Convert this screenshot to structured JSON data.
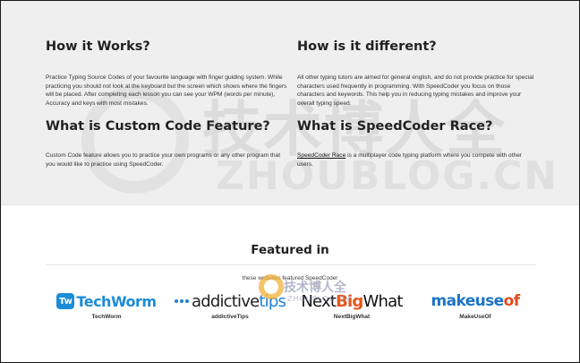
{
  "sections": {
    "how_it_works": {
      "title": "How it Works?",
      "body": "Practice Typing Source Codes of your favourite language with finger guiding system. While practicing you should not look at the keyboard but the screen which shows where the fingers will be placed. After completing each lesson you can see your WPM (words per minute), Accuracy and keys with most mistakes."
    },
    "how_different": {
      "title": "How is it different?",
      "body": "All other typing tutors are aimed for general english, and do not provide practice for special characters used frequently in programming. With SpeedCoder you focus on those characters and keywords. This help you in reducing typing mistakes and improve your overall typing speed."
    },
    "custom_code": {
      "title": "What is Custom Code Feature?",
      "body": "Custom Code feature allows you to practice your own programs or any other program that you would like to practice using SpeedCoder."
    },
    "race": {
      "title": "What is SpeedCoder Race?",
      "link": "SpeedCoder Race",
      "body": " is a multiplayer code typing platform where you compete with other users."
    }
  },
  "watermark": {
    "cn": "技术博人全",
    "en": "ZHOUBLOG.CN",
    "small_cn": "技术博人全",
    "small_en": "ZHOUBLOG.CN"
  },
  "featured": {
    "title": "Featured in",
    "subtitle": "these websites featured SpeedCoder",
    "logos": [
      {
        "brand": "TechWorm",
        "caption": "TechWorm",
        "badge": "Tw",
        "color": "#1b8cd8"
      },
      {
        "brand_main": "addictive",
        "brand_accent": "tips",
        "caption": "addictiveTips",
        "color": "#1e7fd6"
      },
      {
        "brand_pre": "Next",
        "brand_accent": "Big",
        "brand_post": "What",
        "caption": "NextBigWhat",
        "color": "#e8551b"
      },
      {
        "brand_main": "makeuse",
        "brand_accent": "of",
        "caption": "MakeUseOf",
        "color": "#1b74c8"
      }
    ]
  }
}
